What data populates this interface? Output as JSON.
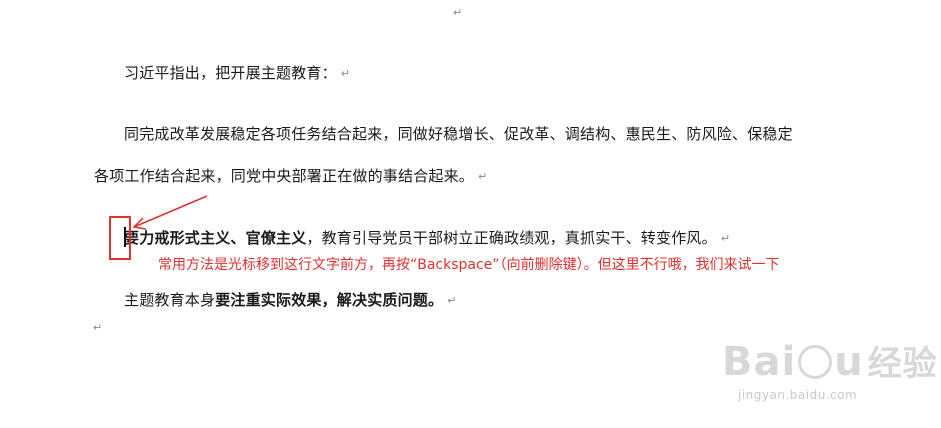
{
  "document": {
    "marks": {
      "paragraph": "↵"
    },
    "p1": "习近平指出，把开展主题教育：",
    "p2_line1": "同完成改革发展稳定各项任务结合起来，同做好稳增长、促改革、调结构、惠民生、防风险、保稳定",
    "p2_line2": "各项工作结合起来，同党中央部署正在做的事结合起来。",
    "p3_bold": "要力戒形式主义、官僚主义",
    "p3_rest": "，教育引导党员干部树立正确政绩观，真抓实干、转变作风。",
    "p4_normal": "主题教育本身",
    "p4_bold": "要注重实际效果，解决实质问题。"
  },
  "annotation": {
    "text": "常用方法是光标移到这行文字前方，再按“Backspace”（向前删除键）。但这里不行哦，我们来试一下",
    "color": "#e0312e"
  },
  "watermark": {
    "logo_text_a": "Bai",
    "logo_text_b": "u",
    "logo_text_cn": "经验",
    "url": "jingyan.baidu.com"
  }
}
